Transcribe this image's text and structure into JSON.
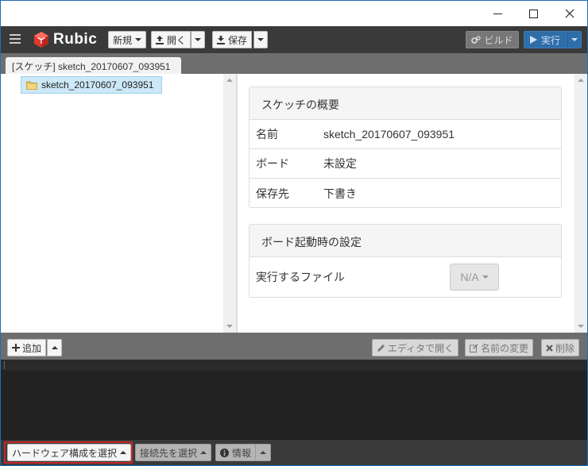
{
  "window": {
    "minimize_label": "—",
    "maximize_label": "☐",
    "close_label": "✕"
  },
  "toolbar": {
    "menu_icon": "hamburger-icon",
    "logo_text": "Rubic",
    "new_label": "新規",
    "open_label": "開く",
    "save_label": "保存",
    "build_label": "ビルド",
    "run_label": "実行"
  },
  "tab": {
    "label": "[スケッチ] sketch_20170607_093951"
  },
  "tree": {
    "items": [
      {
        "label": "sketch_20170607_093951",
        "icon": "folder-icon"
      }
    ]
  },
  "overview": {
    "title": "スケッチの概要",
    "rows": [
      {
        "key": "名前",
        "value": "sketch_20170607_093951"
      },
      {
        "key": "ボード",
        "value": "未設定"
      },
      {
        "key": "保存先",
        "value": "下書き"
      }
    ]
  },
  "boot": {
    "title": "ボード起動時の設定",
    "exec_label": "実行するファイル",
    "exec_value": "N/A"
  },
  "actions": {
    "add_label": "追加",
    "open_in_editor_label": "エディタで開く",
    "rename_label": "名前の変更",
    "delete_label": "削除"
  },
  "status": {
    "hardware_label": "ハードウェア構成を選択",
    "connection_label": "接続先を選択",
    "info_label": "情報"
  },
  "colors": {
    "toolbar_bg": "#3a3a3a",
    "run_button": "#2f6da8",
    "tree_selection": "#cde8f7",
    "highlight_border": "#c62828"
  }
}
